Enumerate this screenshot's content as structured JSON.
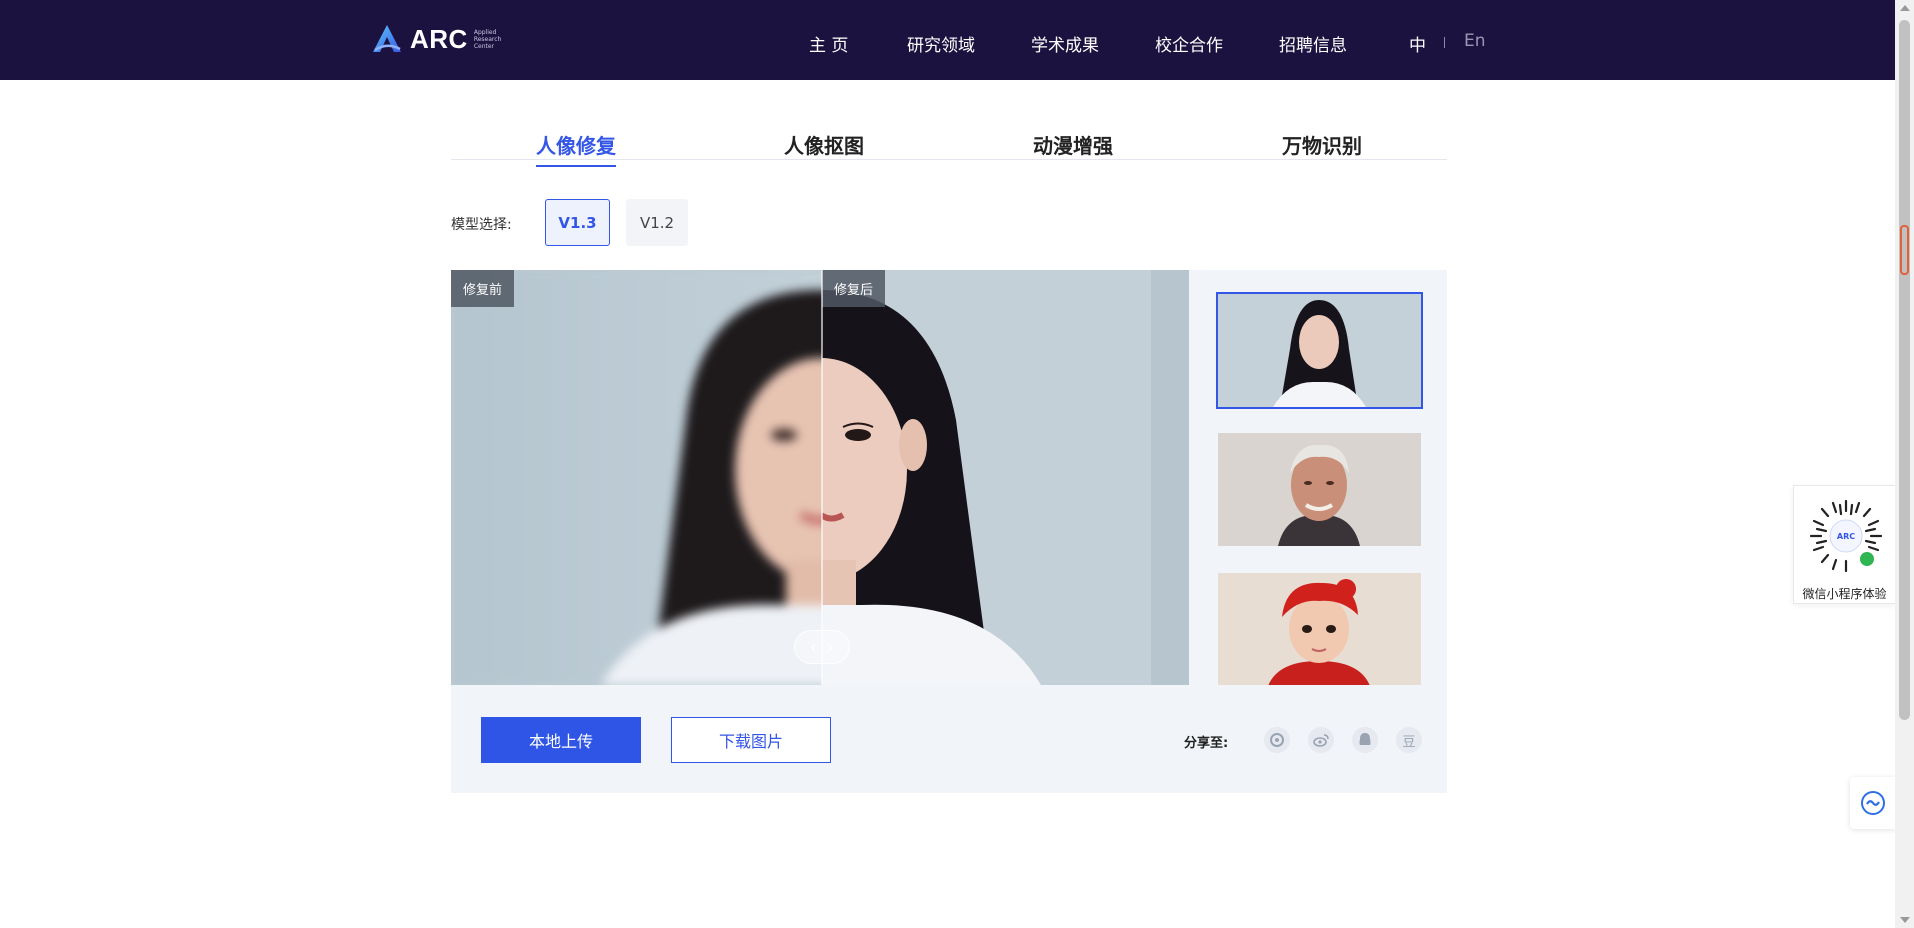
{
  "brand": {
    "name": "ARC",
    "subtitle_lines": [
      "Applied",
      "Research",
      "Center"
    ]
  },
  "nav": {
    "items": [
      "主 页",
      "研究领域",
      "学术成果",
      "校企合作",
      "招聘信息"
    ],
    "lang_zh": "中",
    "lang_en": "En"
  },
  "tabs": [
    "人像修复",
    "人像抠图",
    "动漫增强",
    "万物识别"
  ],
  "model": {
    "label": "模型选择:",
    "versions": [
      "V1.3",
      "V1.2"
    ],
    "selected": "V1.3"
  },
  "compare": {
    "before_label": "修复前",
    "after_label": "修复后",
    "split_fraction": 0.5
  },
  "actions": {
    "upload": "本地上传",
    "download": "下载图片",
    "share_label": "分享至:",
    "share_icons": [
      "moments-icon",
      "weibo-icon",
      "qq-icon",
      "douban-icon"
    ],
    "douban_glyph": "豆"
  },
  "mini_program": {
    "caption": "微信小程序体验"
  },
  "colors": {
    "topbar": "#1c1240",
    "accent": "#3456e6",
    "panel_bg": "#f1f4f8"
  }
}
